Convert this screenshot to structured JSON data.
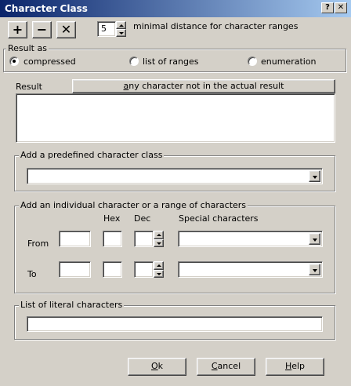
{
  "window": {
    "title": "Character Class",
    "help_glyph": "?",
    "close_glyph": "✕"
  },
  "toolbar": {
    "add_glyph": "+",
    "remove_glyph": "−",
    "clear_glyph": "✕",
    "min_distance_value": "5",
    "min_distance_label": "minimal distance for character ranges"
  },
  "result_as": {
    "legend": "Result as",
    "options": [
      {
        "label": "compressed",
        "checked": true
      },
      {
        "label": "list of ranges",
        "checked": false
      },
      {
        "label": "enumeration",
        "checked": false
      }
    ]
  },
  "result": {
    "label": "Result",
    "invert_button_first": "a",
    "invert_button_rest": "ny character not in the actual result",
    "value": ""
  },
  "predefined": {
    "legend": "Add a predefined character class",
    "selected": ""
  },
  "individual": {
    "legend": "Add an individual character or a range of characters",
    "col_hex": "Hex",
    "col_dec": "Dec",
    "col_special": "Special characters",
    "row_from": "From",
    "row_to": "To"
  },
  "literal": {
    "legend": "List of literal characters",
    "value": ""
  },
  "buttons": {
    "ok_u": "O",
    "ok_rest": "k",
    "cancel_u": "C",
    "cancel_rest": "ancel",
    "help_u": "H",
    "help_rest": "elp"
  }
}
